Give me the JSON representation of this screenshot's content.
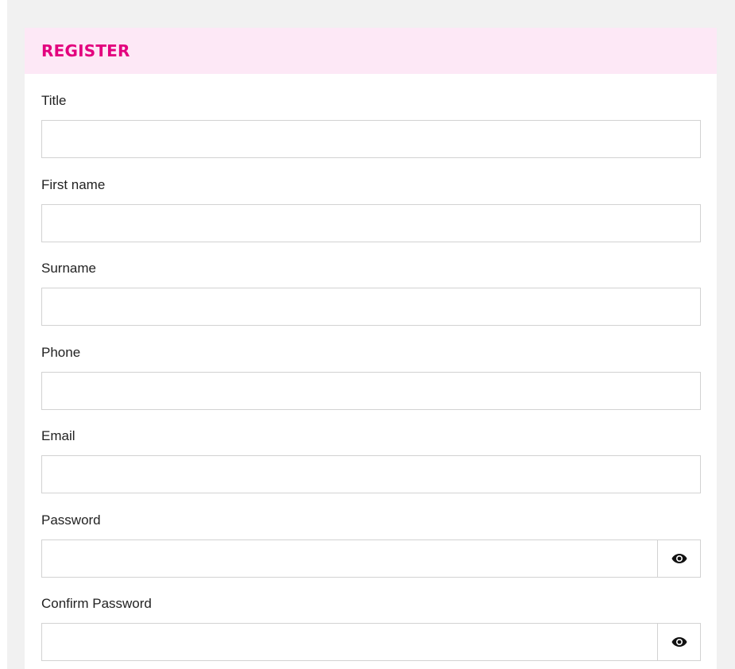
{
  "register": {
    "title": "REGISTER",
    "accent_color": "#e3007e",
    "header_bg": "#fde8f6",
    "fields": [
      {
        "label": "Title",
        "value": ""
      },
      {
        "label": "First name",
        "value": ""
      },
      {
        "label": "Surname",
        "value": ""
      },
      {
        "label": "Phone",
        "value": ""
      },
      {
        "label": "Email",
        "value": ""
      },
      {
        "label": "Password",
        "value": "",
        "icon": "eye-icon"
      },
      {
        "label": "Confirm Password",
        "value": "",
        "icon": "eye-icon"
      }
    ]
  }
}
